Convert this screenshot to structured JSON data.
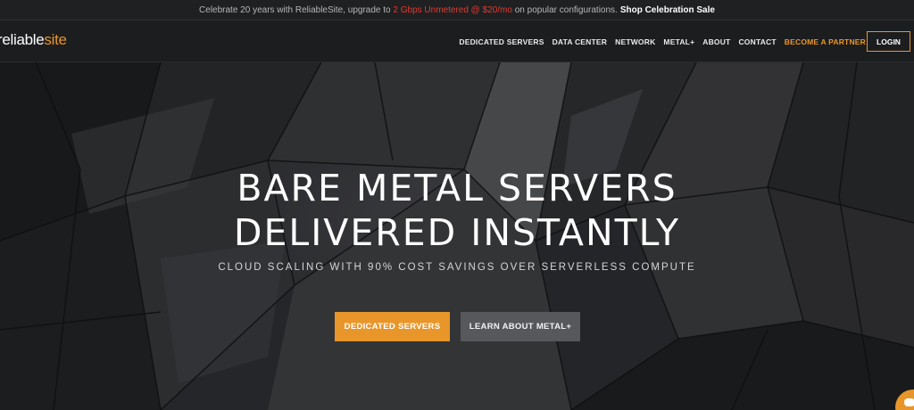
{
  "announcement": {
    "prefix": "Celebrate 20 years with ReliableSite, upgrade to",
    "highlight": "2 Gbps Unmetered @ $20/mo",
    "suffix": "on popular configurations.",
    "link": "Shop Celebration Sale"
  },
  "brand": {
    "part1": "reliable",
    "part2": "site"
  },
  "nav": {
    "items": [
      {
        "label": "DEDICATED SERVERS"
      },
      {
        "label": "DATA CENTER"
      },
      {
        "label": "NETWORK"
      },
      {
        "label": "METAL+"
      },
      {
        "label": "ABOUT"
      },
      {
        "label": "CONTACT"
      },
      {
        "label": "BECOME A PARTNER"
      }
    ],
    "login": "LOGIN"
  },
  "hero": {
    "line1": "BARE METAL SERVERS",
    "line2": "DELIVERED INSTANTLY",
    "subtitle": "CLOUD SCALING WITH 90% COST SAVINGS OVER SERVERLESS COMPUTE",
    "primary_button": "DEDICATED SERVERS",
    "secondary_button": "LEARN ABOUT METAL+"
  },
  "colors": {
    "accent": "#e8962a",
    "highlight": "#e23a2e",
    "background": "#1b1c1e"
  },
  "icons": {
    "chat": "chat-bubble-icon"
  }
}
